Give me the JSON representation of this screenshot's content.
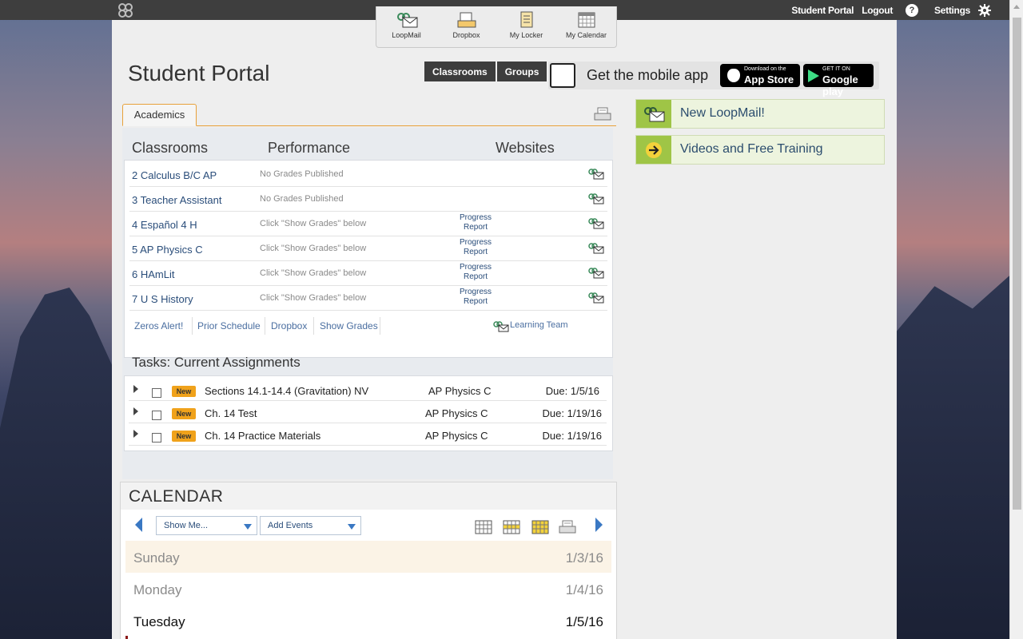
{
  "top_nav": {
    "portal": "Student Portal",
    "logout": "Logout",
    "help": "?",
    "settings": "Settings"
  },
  "toolbar": [
    {
      "label": "LoopMail",
      "icon": "loopmail-icon"
    },
    {
      "label": "Dropbox",
      "icon": "dropbox-icon"
    },
    {
      "label": "My Locker",
      "icon": "locker-icon"
    },
    {
      "label": "My Calendar",
      "icon": "calendar-icon"
    }
  ],
  "page_title": "Student Portal",
  "segments": [
    "Classrooms",
    "Groups"
  ],
  "app_banner": {
    "text": "Get the mobile app",
    "apple_small": "Download on the",
    "apple_big": "App Store",
    "google_small": "GET IT ON",
    "google_big": "Google play"
  },
  "tab": "Academics",
  "columns": {
    "classrooms": "Classrooms",
    "performance": "Performance",
    "websites": "Websites"
  },
  "classes": [
    {
      "name": "2  Calculus B/C AP",
      "performance": "No Grades Published",
      "website": ""
    },
    {
      "name": "3  Teacher Assistant",
      "performance": "No Grades Published",
      "website": ""
    },
    {
      "name": "4  Español 4 H",
      "performance": "Click \"Show Grades\" below",
      "website": "Progress Report"
    },
    {
      "name": "5  AP Physics C",
      "performance": "Click \"Show Grades\" below",
      "website": "Progress Report"
    },
    {
      "name": "6  HAmLit",
      "performance": "Click \"Show Grades\" below",
      "website": "Progress Report"
    },
    {
      "name": "7  U S History",
      "performance": "Click \"Show Grades\" below",
      "website": "Progress Report"
    }
  ],
  "class_footer": {
    "zeros": "Zeros Alert!",
    "prior": "Prior Schedule",
    "dropbox": "Dropbox",
    "show": "Show Grades",
    "learning": "Learning Team"
  },
  "tasks_title": "Tasks: Current Assignments",
  "tasks": [
    {
      "badge": "New",
      "name": "Sections 14.1-14.4 (Gravitation) NV",
      "class": "AP Physics C",
      "due": "Due:  1/5/16"
    },
    {
      "badge": "New",
      "name": "Ch. 14 Test",
      "class": "AP Physics C",
      "due": "Due:  1/19/16"
    },
    {
      "badge": "New",
      "name": "Ch. 14 Practice Materials",
      "class": "AP Physics C",
      "due": "Due:  1/19/16"
    }
  ],
  "promos": [
    {
      "label": "New LoopMail!",
      "icon": "loopmail-icon"
    },
    {
      "label": "Videos and Free Training",
      "icon": "arrow-right-icon"
    }
  ],
  "calendar": {
    "title": "CALENDAR",
    "show_me": "Show Me...",
    "add_events": "Add Events",
    "days": [
      {
        "name": "Sunday",
        "date": "1/3/16"
      },
      {
        "name": "Monday",
        "date": "1/4/16"
      },
      {
        "name": "Tuesday",
        "date": "1/5/16"
      }
    ]
  },
  "colors": {
    "accent_orange": "#e8a13a",
    "badge_orange": "#f0a21b",
    "link_blue": "#2a4d7a",
    "promo_green": "#9fc546",
    "topbar": "#3e3e3e"
  }
}
